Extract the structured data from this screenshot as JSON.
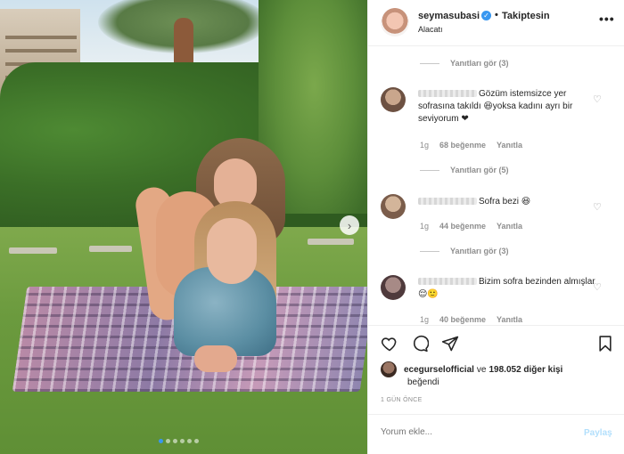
{
  "post": {
    "username": "seymasubasi",
    "follow_label": "Takiptesin",
    "separator": "•",
    "location": "Alacatı",
    "more": "•••"
  },
  "carousel": {
    "next_icon": "chevron-right-icon",
    "dots": 6,
    "active_dot": 0
  },
  "comments": [
    {
      "replies_top": "Yanıtları gör (3)",
      "text": "Gözüm istemsizce yer sofrasına takıldı 😆yoksa kadını ayrı bir seviyorum ❤",
      "time": "1g",
      "likes": "68 beğenme",
      "reply": "Yanıtla"
    },
    {
      "replies_top": "Yanıtları gör (5)",
      "text": "Sofra bezi 😆",
      "time": "1g",
      "likes": "44 beğenme",
      "reply": "Yanıtla"
    },
    {
      "replies_top": "Yanıtları gör (3)",
      "text": "Bizim sofra bezinden almışlar 😌🙂",
      "time": "1g",
      "likes": "40 beğenme",
      "reply": "Yanıtla"
    }
  ],
  "actions": {
    "like_icon": "heart-icon",
    "comment_icon": "comment-icon",
    "share_icon": "paper-plane-icon",
    "save_icon": "bookmark-icon"
  },
  "likes": {
    "user": "ecegurselofficial",
    "connector": "ve",
    "others": "198.052 diğer kişi",
    "liked_text": "beğendi"
  },
  "timestamp": "1 GÜN ÖNCE",
  "comment_box": {
    "placeholder": "Yorum ekle...",
    "share_label": "Paylaş"
  },
  "colors": {
    "accent": "#3897f0",
    "share_disabled": "#b2dffc",
    "muted": "#8e8e8e"
  }
}
